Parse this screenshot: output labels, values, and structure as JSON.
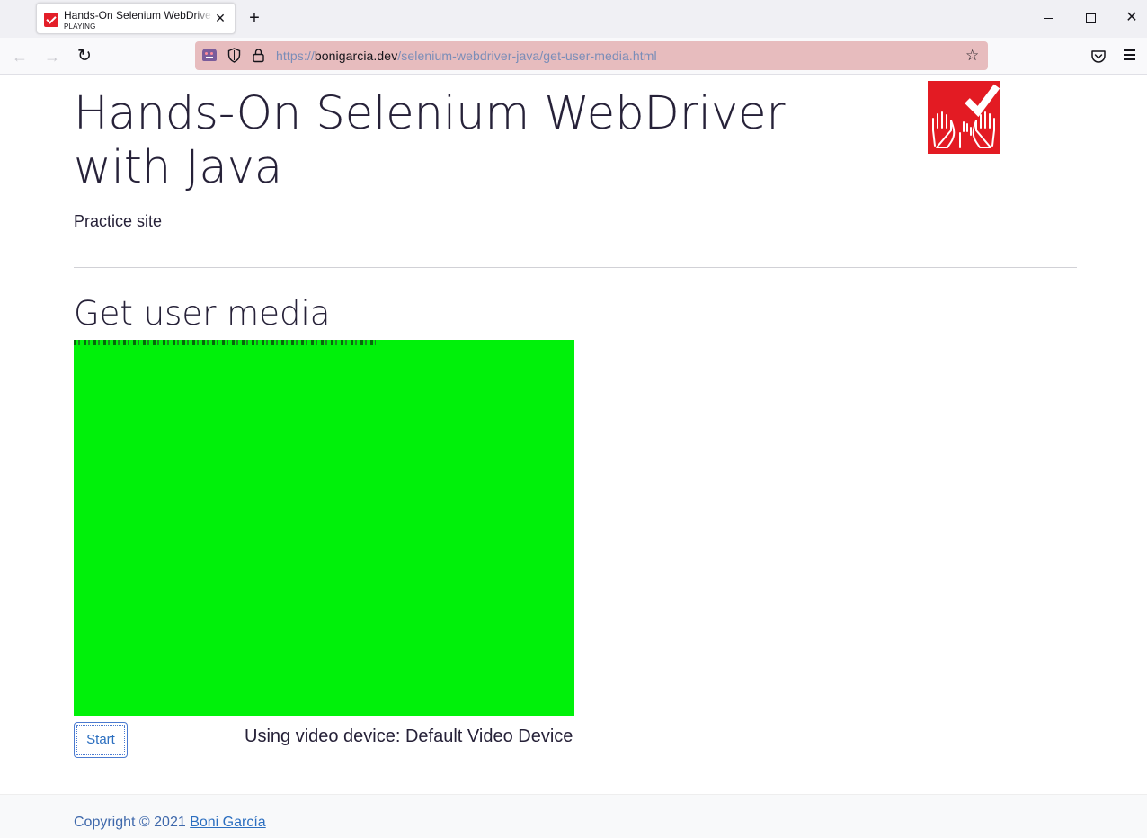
{
  "browser": {
    "tab": {
      "title": "Hands-On Selenium WebDriver with Java",
      "subtitle": "PLAYING",
      "close_label": "✕"
    },
    "new_tab_label": "+",
    "window_controls": {
      "close_label": "✕"
    },
    "nav": {
      "back_label": "←",
      "forward_label": "→",
      "reload_label": "↻"
    },
    "url": {
      "protocol": "https://",
      "host": "bonigarcia.dev",
      "path": "/selenium-webdriver-java/get-user-media.html",
      "bookmark_label": "☆"
    },
    "colors": {
      "urlbar_background": "#e7bcbe",
      "favicon": "#e31e29"
    }
  },
  "page": {
    "title": "Hands-On Selenium WebDriver with Java",
    "subtitle": "Practice site",
    "section_title": "Get user media",
    "video": {
      "color": "#00f10a"
    },
    "start_button_label": "Start",
    "device_status": "Using video device: Default Video Device",
    "footer": {
      "copyright_prefix": "Copyright © 2021 ",
      "author_link": "Boni García"
    },
    "logo": {
      "color": "#e31b23",
      "icon": "hands-checkmark-logo"
    }
  }
}
